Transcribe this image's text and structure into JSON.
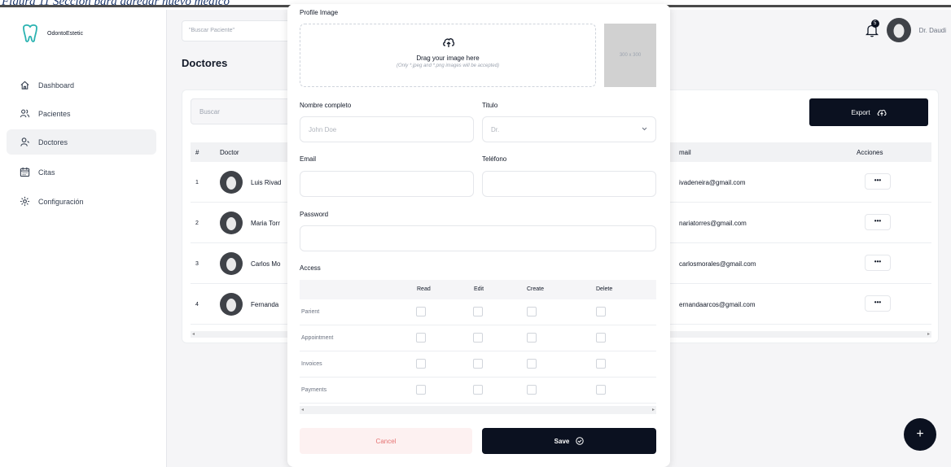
{
  "caption": "Figura 11 Sección para agregar nuevo médico",
  "app": {
    "name": "OdontoEstetic",
    "brand_color": "#2bb3b1",
    "dark_color": "#0b1120"
  },
  "sidebar": {
    "items": [
      {
        "label": "Dashboard",
        "icon": "home-icon"
      },
      {
        "label": "Pacientes",
        "icon": "users-icon"
      },
      {
        "label": "Doctores",
        "icon": "user-icon",
        "active": true
      },
      {
        "label": "Citas",
        "icon": "calendar-icon"
      },
      {
        "label": "Configuración",
        "icon": "gear-icon"
      }
    ]
  },
  "header": {
    "search_placeholder": "\"Buscar Paciente\"",
    "notification_count": "5",
    "user_name": "Dr. Daudi"
  },
  "page": {
    "title": "Doctores",
    "table_search_placeholder": "Buscar",
    "export_label": "Export"
  },
  "table": {
    "columns": [
      "#",
      "Doctor",
      "mail",
      "Acciones"
    ],
    "rows": [
      {
        "num": "1",
        "name": "Luis Rivad",
        "email": "ivadeneira@gmail.com",
        "action": "•••"
      },
      {
        "num": "2",
        "name": "Maria Torr",
        "email": "nariatorres@gmail.com",
        "action": "•••"
      },
      {
        "num": "3",
        "name": "Carlos Mo",
        "email": "carlosmorales@gmail.com",
        "action": "•••"
      },
      {
        "num": "4",
        "name": "Fernanda",
        "email": "ernandaarcos@gmail.com",
        "action": "•••"
      }
    ],
    "scroll_left": "◂",
    "scroll_right": "▸"
  },
  "modal": {
    "profile_image_label": "Profile Image",
    "drop_title": "Drag your image here",
    "drop_sub": "(Only *.jpeg and *.png images will be accepted)",
    "preview_size": "300 x 300",
    "fullname_label": "Nombre completo",
    "fullname_placeholder": "John Doe",
    "title_label": "Titulo",
    "title_value": "Dr.",
    "email_label": "Email",
    "phone_label": "Teléfono",
    "password_label": "Password",
    "access_label": "Access",
    "access_columns": [
      "Read",
      "Edit",
      "Create",
      "Delete"
    ],
    "access_rows": [
      "Parient",
      "Appointment",
      "Invoices",
      "Payments"
    ],
    "cancel_label": "Cancel",
    "save_label": "Save"
  },
  "fab_label": "+"
}
